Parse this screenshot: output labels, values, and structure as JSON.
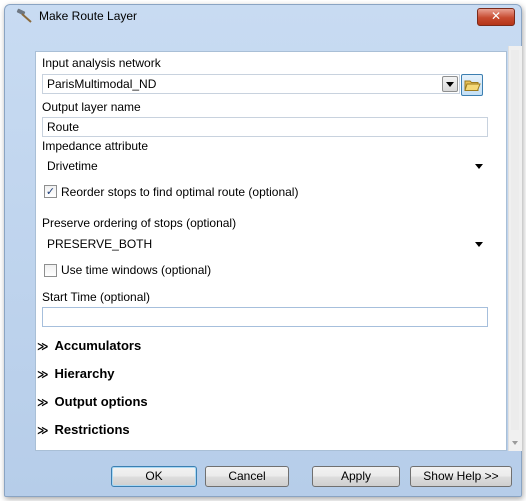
{
  "window": {
    "title": "Make Route Layer",
    "close_glyph": "✕",
    "title_icon": "hammer-icon",
    "accent": "#3c7fb1"
  },
  "form": {
    "network": {
      "label": "Input analysis network",
      "value": "ParisMultimodal_ND"
    },
    "output_layer": {
      "label": "Output layer name",
      "value": "Route"
    },
    "impedance": {
      "label": "Impedance attribute",
      "value": "Drivetime"
    },
    "reorder": {
      "label": "Reorder stops to find optimal route (optional)",
      "checked": true
    },
    "preserve": {
      "label": "Preserve ordering of stops (optional)",
      "value": "PRESERVE_BOTH"
    },
    "time_windows": {
      "label": "Use time windows (optional)",
      "checked": false
    },
    "start_time": {
      "label": "Start Time (optional)",
      "value": ""
    }
  },
  "sections": [
    {
      "label": "Accumulators",
      "icon": "chevron-double-down-icon"
    },
    {
      "label": "Hierarchy",
      "icon": "chevron-double-down-icon"
    },
    {
      "label": "Output options",
      "icon": "chevron-double-down-icon"
    },
    {
      "label": "Restrictions",
      "icon": "chevron-double-down-icon"
    }
  ],
  "section_glyph": "≫",
  "check_glyph": "✓",
  "buttons": {
    "ok": "OK",
    "cancel": "Cancel",
    "apply": "Apply",
    "help": "Show Help >>"
  }
}
